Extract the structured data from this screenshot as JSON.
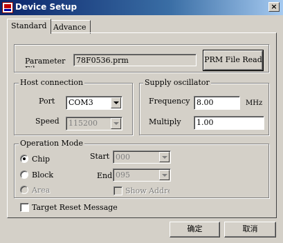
{
  "window": {
    "title": "Device Setup",
    "close_glyph": "×"
  },
  "tabs": [
    {
      "label": "Standard",
      "active": true
    },
    {
      "label": "Advance",
      "active": false
    }
  ],
  "parameter": {
    "label": "Parameter",
    "label_clipped": "Fil",
    "file_value": "78F0536.prm",
    "read_button": "PRM File Read"
  },
  "host_connection": {
    "title": "Host connection",
    "port_label": "Port",
    "port_value": "COM3",
    "speed_label": "Speed",
    "speed_value": "115200"
  },
  "supply_oscillator": {
    "title": "Supply oscillator",
    "frequency_label": "Frequency",
    "frequency_value": "8.00",
    "frequency_unit": "MHz",
    "multiply_label": "Multiply",
    "multiply_value": "1.00"
  },
  "operation_mode": {
    "title": "Operation Mode",
    "chip_label": "Chip",
    "block_label": "Block",
    "area_label": "Area",
    "start_label": "Start",
    "start_value": "000",
    "end_label": "End",
    "end_value": "095",
    "show_address_label": "Show Addre:"
  },
  "target_reset": {
    "label": "Target Reset Message",
    "checked": false
  },
  "footer": {
    "ok_label": "确定",
    "cancel_label": "取消"
  }
}
